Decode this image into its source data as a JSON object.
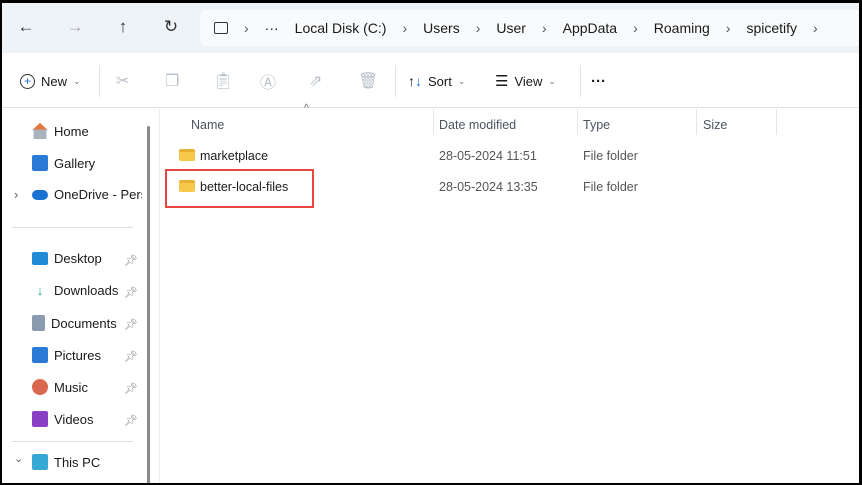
{
  "nav": {
    "back": "←",
    "forward": "→",
    "up": "↑",
    "refresh": "↻"
  },
  "breadcrumb": {
    "more": "···",
    "items": [
      "Local Disk (C:)",
      "Users",
      "User",
      "AppData",
      "Roaming",
      "spicetify"
    ],
    "separator": "›"
  },
  "toolbar": {
    "new_label": "New",
    "sort_label": "Sort",
    "view_label": "View",
    "more": "···"
  },
  "sidebar": {
    "items": [
      {
        "label": "Home"
      },
      {
        "label": "Gallery"
      },
      {
        "label": "OneDrive - Perso"
      }
    ],
    "quick": [
      {
        "label": "Desktop"
      },
      {
        "label": "Downloads"
      },
      {
        "label": "Documents"
      },
      {
        "label": "Pictures"
      },
      {
        "label": "Music"
      },
      {
        "label": "Videos"
      }
    ],
    "this_pc": "This PC"
  },
  "columns": {
    "name": "Name",
    "date": "Date modified",
    "type": "Type",
    "size": "Size"
  },
  "files": [
    {
      "name": "marketplace",
      "date": "28-05-2024 11:51",
      "type": "File folder"
    },
    {
      "name": "better-local-files",
      "date": "28-05-2024 13:35",
      "type": "File folder"
    }
  ],
  "colors": {
    "highlight": "#e8473f"
  }
}
